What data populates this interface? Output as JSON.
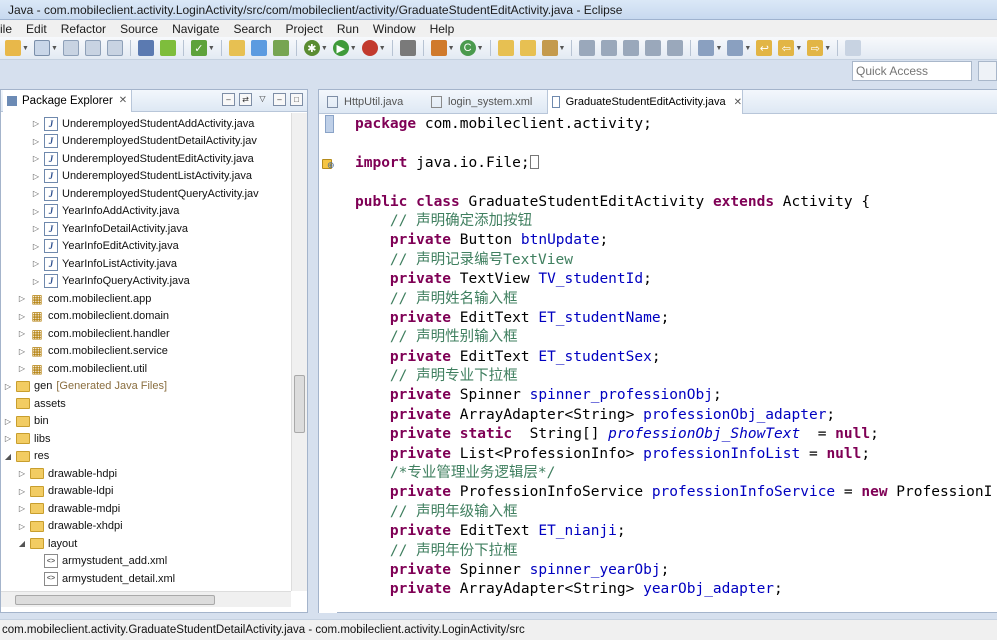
{
  "window": {
    "title": "Java - com.mobileclient.activity.LoginActivity/src/com/mobileclient/activity/GraduateStudentEditActivity.java - Eclipse"
  },
  "menu": [
    "ile",
    "Edit",
    "Refactor",
    "Source",
    "Navigate",
    "Search",
    "Project",
    "Run",
    "Window",
    "Help"
  ],
  "quick_access": {
    "placeholder": "Quick Access"
  },
  "explorer": {
    "title": "Package Explorer",
    "items": [
      {
        "label": "UnderemployedStudentAddActivity.java",
        "type": "java",
        "indent": 4,
        "expand": "closed"
      },
      {
        "label": "UnderemployedStudentDetailActivity.jav",
        "type": "java",
        "indent": 4,
        "expand": "closed"
      },
      {
        "label": "UnderemployedStudentEditActivity.java",
        "type": "java",
        "indent": 4,
        "expand": "closed"
      },
      {
        "label": "UnderemployedStudentListActivity.java",
        "type": "java",
        "indent": 4,
        "expand": "closed"
      },
      {
        "label": "UnderemployedStudentQueryActivity.jav",
        "type": "java",
        "indent": 4,
        "expand": "closed"
      },
      {
        "label": "YearInfoAddActivity.java",
        "type": "java",
        "indent": 4,
        "expand": "closed"
      },
      {
        "label": "YearInfoDetailActivity.java",
        "type": "java",
        "indent": 4,
        "expand": "closed"
      },
      {
        "label": "YearInfoEditActivity.java",
        "type": "java",
        "indent": 4,
        "expand": "closed"
      },
      {
        "label": "YearInfoListActivity.java",
        "type": "java",
        "indent": 4,
        "expand": "closed"
      },
      {
        "label": "YearInfoQueryActivity.java",
        "type": "java",
        "indent": 4,
        "expand": "closed"
      },
      {
        "label": "com.mobileclient.app",
        "type": "package",
        "indent": 3,
        "expand": "closed"
      },
      {
        "label": "com.mobileclient.domain",
        "type": "package",
        "indent": 3,
        "expand": "closed"
      },
      {
        "label": "com.mobileclient.handler",
        "type": "package",
        "indent": 3,
        "expand": "closed"
      },
      {
        "label": "com.mobileclient.service",
        "type": "package",
        "indent": 3,
        "expand": "closed"
      },
      {
        "label": "com.mobileclient.util",
        "type": "package",
        "indent": 3,
        "expand": "closed"
      },
      {
        "label": "gen",
        "suffix": "[Generated Java Files]",
        "type": "folder",
        "indent": 2,
        "expand": "closed"
      },
      {
        "label": "assets",
        "type": "folder",
        "indent": 2,
        "expand": "none"
      },
      {
        "label": "bin",
        "type": "folder",
        "indent": 2,
        "expand": "closed"
      },
      {
        "label": "libs",
        "type": "folder",
        "indent": 2,
        "expand": "closed"
      },
      {
        "label": "res",
        "type": "folder",
        "indent": 2,
        "expand": "open"
      },
      {
        "label": "drawable-hdpi",
        "type": "folder",
        "indent": 3,
        "expand": "closed"
      },
      {
        "label": "drawable-ldpi",
        "type": "folder",
        "indent": 3,
        "expand": "closed"
      },
      {
        "label": "drawable-mdpi",
        "type": "folder",
        "indent": 3,
        "expand": "closed"
      },
      {
        "label": "drawable-xhdpi",
        "type": "folder",
        "indent": 3,
        "expand": "closed"
      },
      {
        "label": "layout",
        "type": "folder",
        "indent": 3,
        "expand": "open"
      },
      {
        "label": "armystudent_add.xml",
        "type": "xml",
        "indent": 4,
        "expand": "none"
      },
      {
        "label": "armystudent_detail.xml",
        "type": "xml",
        "indent": 4,
        "expand": "none"
      }
    ]
  },
  "editor": {
    "tabs": [
      {
        "label": "HttpUtil.java",
        "active": false
      },
      {
        "label": "login_system.xml",
        "active": false
      },
      {
        "label": "GraduateStudentEditActivity.java",
        "active": true
      }
    ],
    "lines": [
      [
        [
          "kw",
          "package"
        ],
        [
          "t",
          " com.mobileclient.activity;"
        ]
      ],
      [],
      [
        [
          "kw",
          "import"
        ],
        [
          "t",
          " java.io.File;"
        ],
        [
          "cursor",
          ""
        ]
      ],
      [],
      [
        [
          "kw",
          "public class"
        ],
        [
          "t",
          " GraduateStudentEditActivity "
        ],
        [
          "kw",
          "extends"
        ],
        [
          "t",
          " Activity {"
        ]
      ],
      [
        [
          "t",
          "    "
        ],
        [
          "cm",
          "// 声明确定添加按钮"
        ]
      ],
      [
        [
          "t",
          "    "
        ],
        [
          "kw",
          "private"
        ],
        [
          "t",
          " Button "
        ],
        [
          "fld",
          "btnUpdate"
        ],
        [
          "t",
          ";"
        ]
      ],
      [
        [
          "t",
          "    "
        ],
        [
          "cm",
          "// 声明记录编号TextView"
        ]
      ],
      [
        [
          "t",
          "    "
        ],
        [
          "kw",
          "private"
        ],
        [
          "t",
          " TextView "
        ],
        [
          "fld",
          "TV_studentId"
        ],
        [
          "t",
          ";"
        ]
      ],
      [
        [
          "t",
          "    "
        ],
        [
          "cm",
          "// 声明姓名输入框"
        ]
      ],
      [
        [
          "t",
          "    "
        ],
        [
          "kw",
          "private"
        ],
        [
          "t",
          " EditText "
        ],
        [
          "fld",
          "ET_studentName"
        ],
        [
          "t",
          ";"
        ]
      ],
      [
        [
          "t",
          "    "
        ],
        [
          "cm",
          "// 声明性别输入框"
        ]
      ],
      [
        [
          "t",
          "    "
        ],
        [
          "kw",
          "private"
        ],
        [
          "t",
          " EditText "
        ],
        [
          "fld",
          "ET_studentSex"
        ],
        [
          "t",
          ";"
        ]
      ],
      [
        [
          "t",
          "    "
        ],
        [
          "cm",
          "// 声明专业下拉框"
        ]
      ],
      [
        [
          "t",
          "    "
        ],
        [
          "kw",
          "private"
        ],
        [
          "t",
          " Spinner "
        ],
        [
          "fld",
          "spinner_professionObj"
        ],
        [
          "t",
          ";"
        ]
      ],
      [
        [
          "t",
          "    "
        ],
        [
          "kw",
          "private"
        ],
        [
          "t",
          " ArrayAdapter<String> "
        ],
        [
          "fld",
          "professionObj_adapter"
        ],
        [
          "t",
          ";"
        ]
      ],
      [
        [
          "t",
          "    "
        ],
        [
          "kw",
          "private static"
        ],
        [
          "t",
          "  String[] "
        ],
        [
          "ifld",
          "professionObj_ShowText"
        ],
        [
          "t",
          "  = "
        ],
        [
          "kw",
          "null"
        ],
        [
          "t",
          ";"
        ]
      ],
      [
        [
          "t",
          "    "
        ],
        [
          "kw",
          "private"
        ],
        [
          "t",
          " List<ProfessionInfo> "
        ],
        [
          "fld",
          "professionInfoList"
        ],
        [
          "t",
          " = "
        ],
        [
          "kw",
          "null"
        ],
        [
          "t",
          ";"
        ]
      ],
      [
        [
          "t",
          "    "
        ],
        [
          "cm",
          "/*专业管理业务逻辑层*/"
        ]
      ],
      [
        [
          "t",
          "    "
        ],
        [
          "kw",
          "private"
        ],
        [
          "t",
          " ProfessionInfoService "
        ],
        [
          "fld",
          "professionInfoService"
        ],
        [
          "t",
          " = "
        ],
        [
          "kw",
          "new"
        ],
        [
          "t",
          " ProfessionI"
        ]
      ],
      [
        [
          "t",
          "    "
        ],
        [
          "cm",
          "// 声明年级输入框"
        ]
      ],
      [
        [
          "t",
          "    "
        ],
        [
          "kw",
          "private"
        ],
        [
          "t",
          " EditText "
        ],
        [
          "fld",
          "ET_nianji"
        ],
        [
          "t",
          ";"
        ]
      ],
      [
        [
          "t",
          "    "
        ],
        [
          "cm",
          "// 声明年份下拉框"
        ]
      ],
      [
        [
          "t",
          "    "
        ],
        [
          "kw",
          "private"
        ],
        [
          "t",
          " Spinner "
        ],
        [
          "fld",
          "spinner_yearObj"
        ],
        [
          "t",
          ";"
        ]
      ],
      [
        [
          "t",
          "    "
        ],
        [
          "kw",
          "private"
        ],
        [
          "t",
          " ArrayAdapter<String> "
        ],
        [
          "fld",
          "yearObj_adapter"
        ],
        [
          "t",
          ";"
        ]
      ]
    ]
  },
  "status": {
    "text": "com.mobileclient.activity.GraduateStudentDetailActivity.java - com.mobileclient.activity.LoginActivity/src"
  },
  "colors": {
    "keyword": "#7f0055",
    "comment": "#3f7f5f",
    "field": "#0000c0"
  }
}
